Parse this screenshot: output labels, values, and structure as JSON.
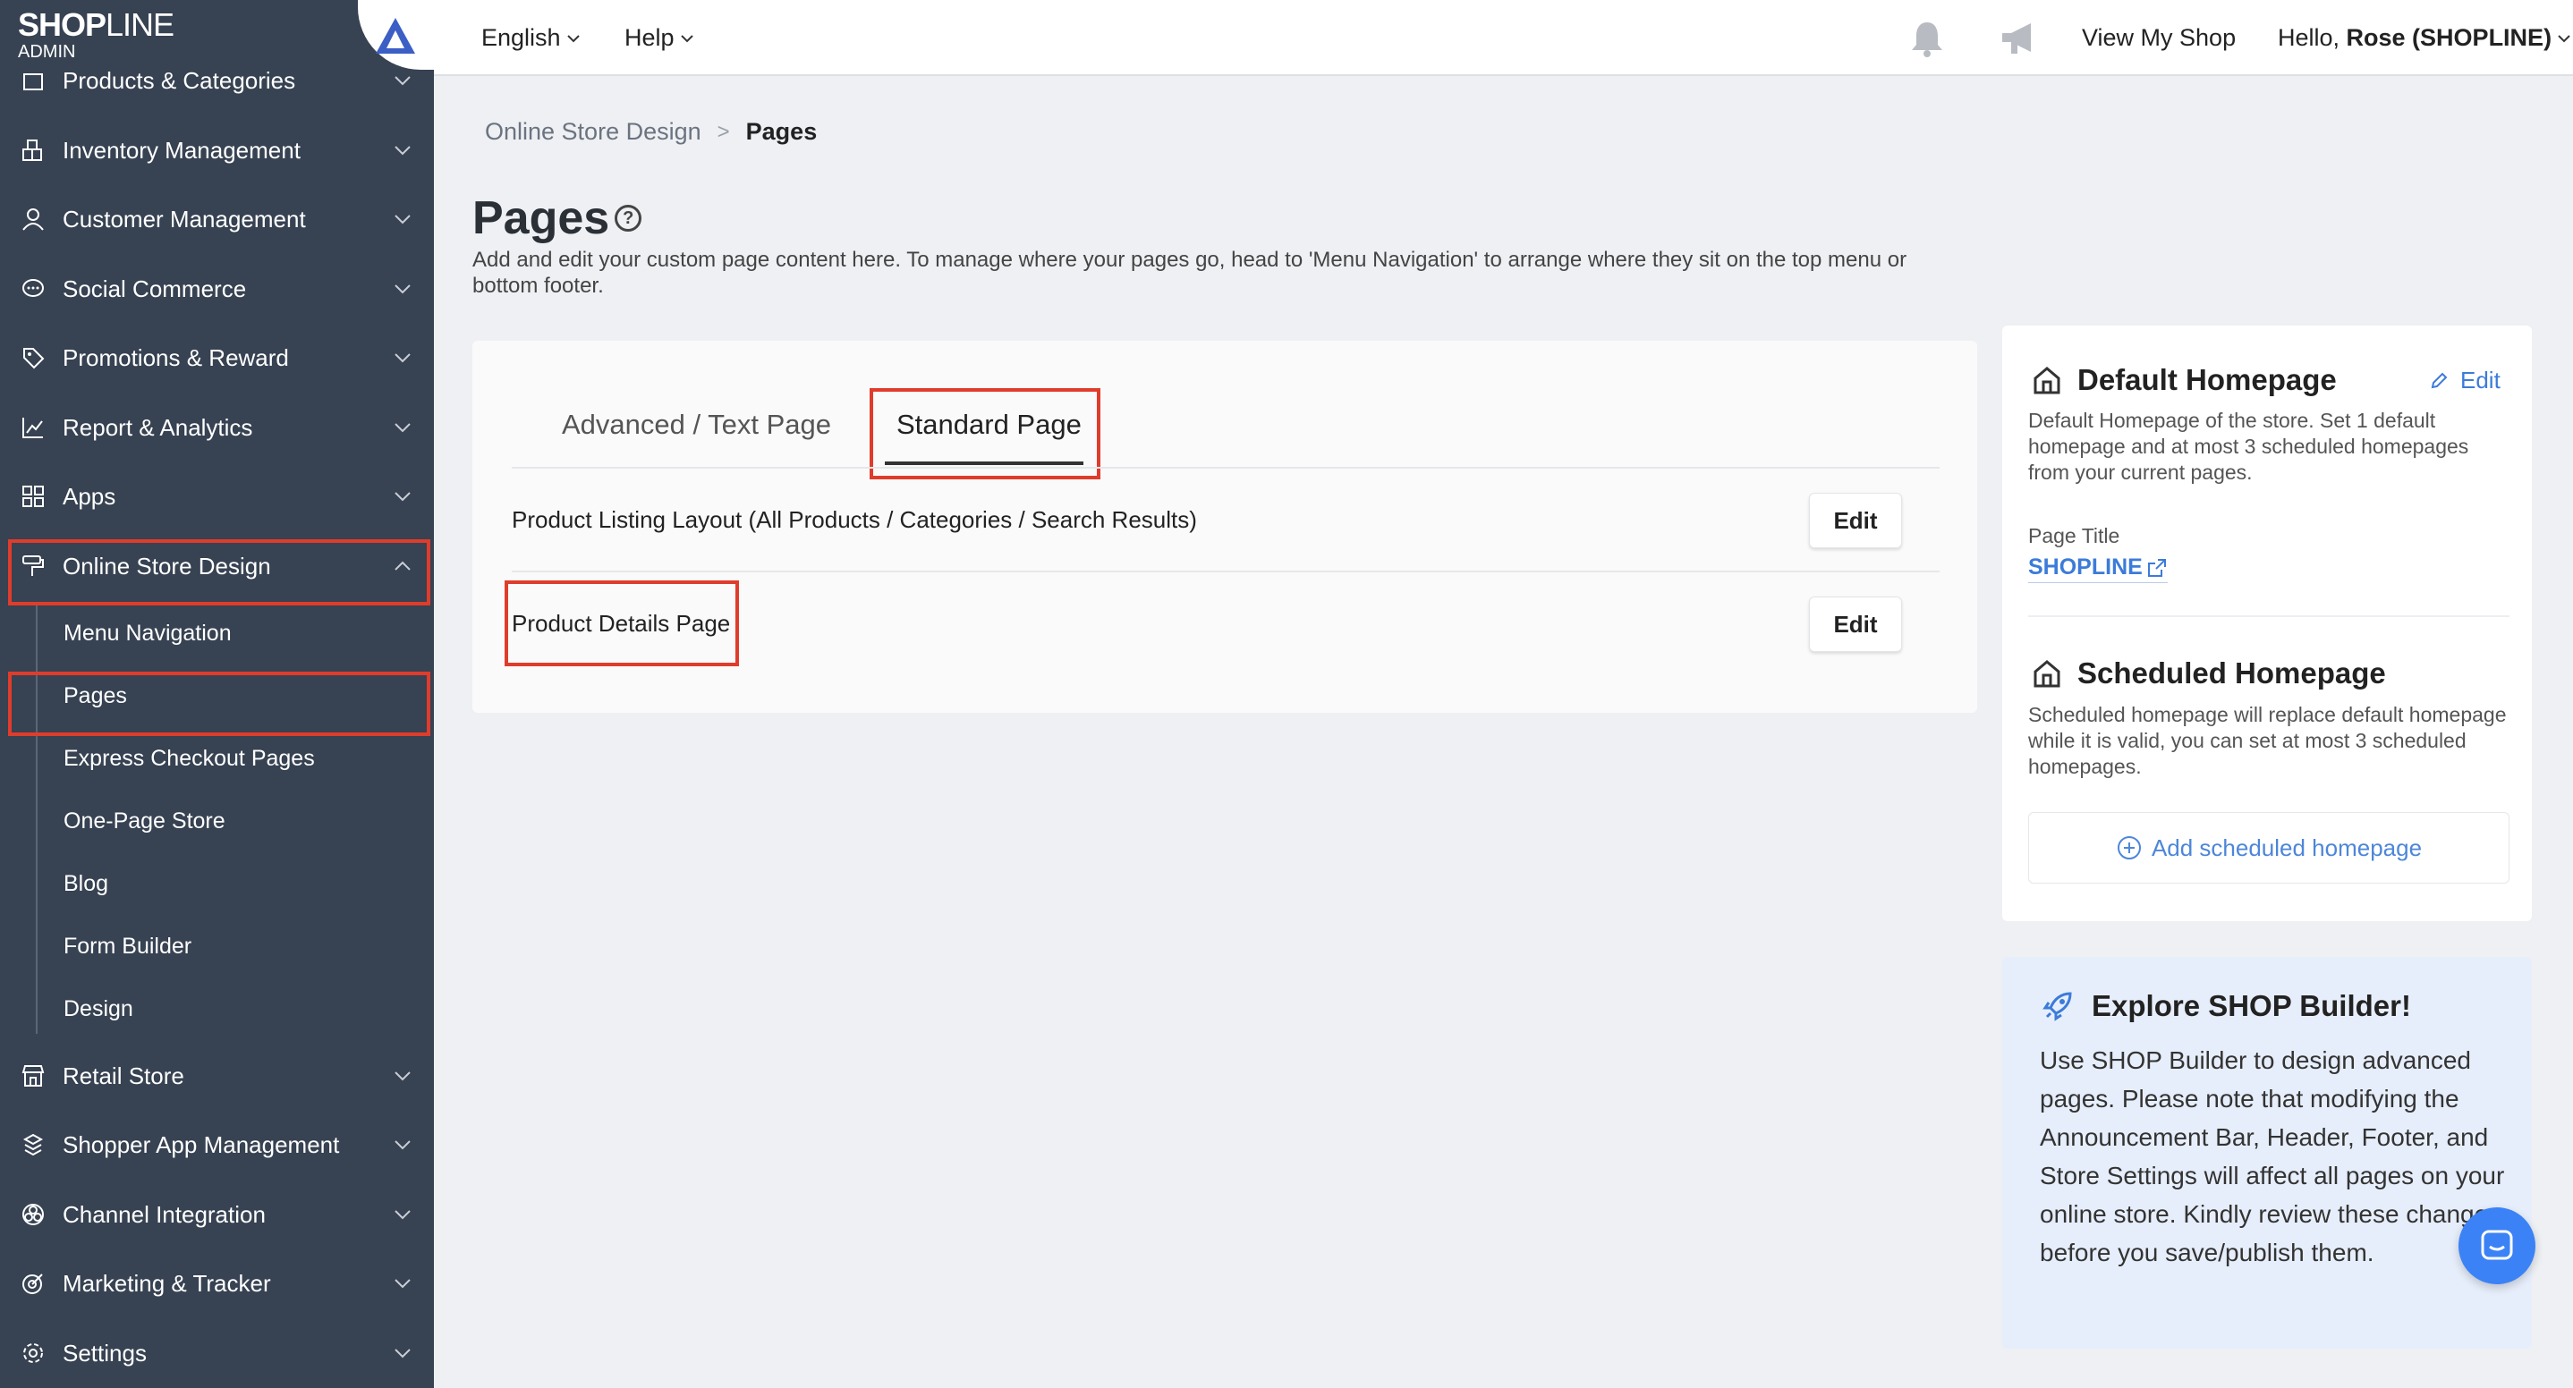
{
  "brand": {
    "logo_main": "SHOP",
    "logo_thin": "LINE",
    "logo_sub": "ADMIN"
  },
  "topbar": {
    "language": "English",
    "help": "Help",
    "view_shop": "View My Shop",
    "greeting_prefix": "Hello, ",
    "user": "Rose (SHOPLINE)"
  },
  "sidebar": {
    "items": [
      {
        "label": "Products & Categories",
        "icon": "box-icon"
      },
      {
        "label": "Inventory Management",
        "icon": "warehouse-icon"
      },
      {
        "label": "Customer Management",
        "icon": "user-icon"
      },
      {
        "label": "Social Commerce",
        "icon": "chat-icon"
      },
      {
        "label": "Promotions & Reward",
        "icon": "tag-icon"
      },
      {
        "label": "Report & Analytics",
        "icon": "chart-icon"
      },
      {
        "label": "Apps",
        "icon": "apps-icon"
      },
      {
        "label": "Online Store Design",
        "icon": "paint-roller-icon"
      },
      {
        "label": "Retail Store",
        "icon": "store-icon"
      },
      {
        "label": "Shopper App Management",
        "icon": "mobile-icon"
      },
      {
        "label": "Channel Integration",
        "icon": "channel-icon"
      },
      {
        "label": "Marketing & Tracker",
        "icon": "target-icon"
      },
      {
        "label": "Settings",
        "icon": "gear-icon"
      }
    ],
    "sub_items": [
      "Menu Navigation",
      "Pages",
      "Express Checkout Pages",
      "One-Page Store",
      "Blog",
      "Form Builder",
      "Design"
    ]
  },
  "breadcrumb": {
    "parent": "Online Store Design",
    "separator": ">",
    "current": "Pages"
  },
  "page": {
    "title": "Pages",
    "help_glyph": "?",
    "description": "Add and edit your custom page content here. To manage where your pages go, head to 'Menu Navigation' to arrange where they sit on the top menu or bottom footer."
  },
  "tabs": [
    {
      "label": "Advanced / Text Page",
      "active": false
    },
    {
      "label": "Standard Page",
      "active": true
    }
  ],
  "standard_pages": [
    {
      "label": "Product Listing Layout (All Products / Categories / Search Results)",
      "action": "Edit"
    },
    {
      "label": "Product Details Page",
      "action": "Edit"
    }
  ],
  "default_homepage": {
    "title": "Default Homepage",
    "edit": "Edit",
    "description": "Default Homepage of the store. Set 1 default homepage and at most 3 scheduled homepages from your current pages.",
    "field_label": "Page Title",
    "field_value": "SHOPLINE"
  },
  "scheduled_homepage": {
    "title": "Scheduled Homepage",
    "description": "Scheduled homepage will replace default homepage while it is valid, you can set at most 3 scheduled homepages.",
    "add_label": "Add scheduled homepage"
  },
  "promo": {
    "title": "Explore SHOP Builder!",
    "text": "Use SHOP Builder to design advanced pages. Please note that modifying the Announcement Bar, Header, Footer, and Store Settings will affect all pages on your online store. Kindly review these changes before you save/publish them."
  },
  "colors": {
    "sidebar_bg": "#374252",
    "accent_blue": "#3c7bd9",
    "highlight_red": "#e03c2c",
    "promo_bg": "#e7eefb"
  }
}
